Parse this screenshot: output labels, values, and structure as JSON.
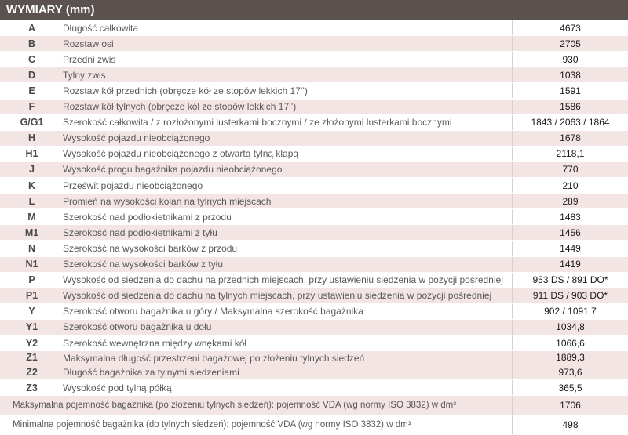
{
  "title": "WYMIARY (mm)",
  "rows": [
    {
      "code": "A",
      "desc": "Długość całkowita",
      "value": "4673"
    },
    {
      "code": "B",
      "desc": "Rozstaw osi",
      "value": "2705"
    },
    {
      "code": "C",
      "desc": "Przedni zwis",
      "value": "930"
    },
    {
      "code": "D",
      "desc": "Tylny zwis",
      "value": "1038"
    },
    {
      "code": "E",
      "desc": "Rozstaw kół przednich (obręcze kół ze stopów lekkich 17’’)",
      "value": "1591"
    },
    {
      "code": "F",
      "desc": "Rozstaw kół tylnych (obręcze kół ze stopów lekkich 17’’)",
      "value": "1586"
    },
    {
      "code": "G/G1",
      "desc": "Szerokość całkowita / z rozłożonymi lusterkami bocznymi / ze złożonymi lusterkami bocznymi",
      "value": "1843 / 2063 / 1864"
    },
    {
      "code": "H",
      "desc": "Wysokość pojazdu nieobciążonego",
      "value": "1678"
    },
    {
      "code": "H1",
      "desc": "Wysokość pojazdu nieobciążonego z otwartą tylną klapą",
      "value": "2118,1"
    },
    {
      "code": "J",
      "desc": "Wysokość progu bagażnika pojazdu nieobciążonego",
      "value": "770"
    },
    {
      "code": "K",
      "desc": "Prześwit pojazdu nieobciążonego",
      "value": "210"
    },
    {
      "code": "L",
      "desc": "Promień na wysokości kolan na tylnych miejscach",
      "value": "289"
    },
    {
      "code": "M",
      "desc": "Szerokość nad podłokietnikami z przodu",
      "value": "1483"
    },
    {
      "code": "M1",
      "desc": " Szerokość nad podłokietnikami z tyłu",
      "value": "1456"
    },
    {
      "code": "N",
      "desc": "Szerokość na wysokości barków z przodu",
      "value": "1449"
    },
    {
      "code": "N1",
      "desc": "Szerokość na wysokości barków z tyłu",
      "value": "1419"
    },
    {
      "code": "P",
      "desc": "Wysokość od siedzenia do dachu na przednich miejscach, przy ustawieniu siedzenia w pozycji pośredniej",
      "value": "953 DS / 891 DO*"
    },
    {
      "code": "P1",
      "desc": "Wysokość od siedzenia do dachu na tylnych miejscach, przy ustawieniu siedzenia w pozycji pośredniej",
      "value": "911 DS / 903 DO*"
    },
    {
      "code": "Y",
      "desc": "Szerokość otworu bagażnika u góry / Maksymalna szerokość bagażnika",
      "value": "902 / 1091,7"
    },
    {
      "code": "Y1",
      "desc": "Szerokość otworu bagażnika u dołu",
      "value": "1034,8"
    },
    {
      "code": "Y2",
      "desc": "Szerokość wewnętrzna między wnękami kół",
      "value": "1066,6"
    }
  ],
  "z_group": {
    "codes": [
      "Z1",
      "Z2"
    ],
    "descs": [
      "Maksymalna długość przestrzeni bagażowej po złożeniu tylnych siedzeń",
      "Długość bagażnika za tylnymi siedzeniami"
    ],
    "values": [
      "1889,3",
      "973,6"
    ]
  },
  "z3": {
    "code": "Z3",
    "desc": "Wysokość pod tylną półką",
    "value": "365,5"
  },
  "summary": [
    {
      "desc": "Maksymalna pojemność bagażnika (po złożeniu tylnych siedzeń): pojemność  VDA (wg normy ISO 3832) w dm³",
      "value": "1706"
    },
    {
      "desc": "Minimalna pojemność bagażnika (do tylnych siedzeń): pojemność  VDA (wg normy ISO 3832) w dm³",
      "value": "498"
    }
  ]
}
